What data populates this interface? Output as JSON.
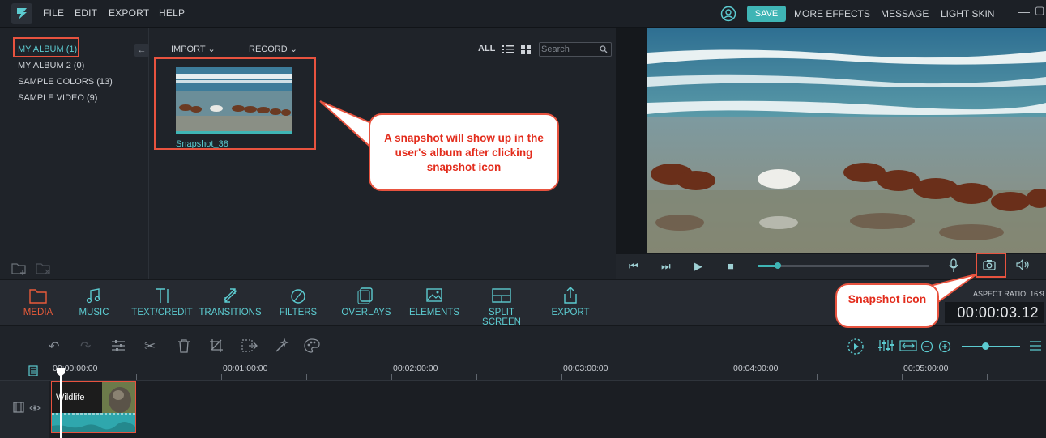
{
  "menu": {
    "items": [
      "FILE",
      "EDIT",
      "EXPORT",
      "HELP"
    ]
  },
  "topbar": {
    "save": "SAVE",
    "more_effects": "MORE EFFECTS",
    "message": "MESSAGE",
    "light_skin": "LIGHT SKIN"
  },
  "albums": [
    "MY ALBUM (1)",
    "MY ALBUM 2 (0)",
    "SAMPLE COLORS (13)",
    "SAMPLE VIDEO (9)"
  ],
  "library": {
    "import": "IMPORT",
    "record": "RECORD",
    "all": "ALL",
    "search_placeholder": "Search",
    "item_caption": "Snapshot_38"
  },
  "player": {
    "progress": 0.12
  },
  "tabs": [
    "MEDIA",
    "MUSIC",
    "TEXT/CREDIT",
    "TRANSITIONS",
    "FILTERS",
    "OVERLAYS",
    "ELEMENTS",
    "SPLIT SCREEN",
    "EXPORT"
  ],
  "aspect_ratio": "ASPECT RATIO: 16:9",
  "timecode": "00:00:03.12",
  "timeline": {
    "ticks": [
      "00:00:00:00",
      "00:01:00:00",
      "00:02:00:00",
      "00:03:00:00",
      "00:04:00:00",
      "00:05:00:00"
    ],
    "clip_title": "Wildlife",
    "zoom_level": 0.4
  },
  "annotations": {
    "callout_1": "A snapshot will show up in the user's album after clicking snapshot icon",
    "callout_2": "Snapshot icon"
  },
  "colors": {
    "accent": "#3fb5b5",
    "active_tab": "#e85b3a",
    "highlight": "#e8533f"
  }
}
